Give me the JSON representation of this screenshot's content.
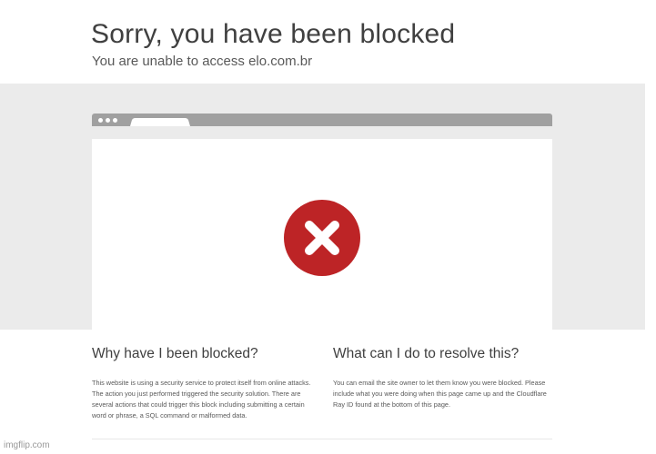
{
  "header": {
    "title": "Sorry, you have been blocked",
    "subtitle": "You are unable to access elo.com.br"
  },
  "illustration": {
    "icon": "error-x-icon",
    "icon_color": "#bd2426"
  },
  "why_blocked": {
    "heading": "Why have I been blocked?",
    "body": "This website is using a security service to protect itself from online attacks. The action you just performed triggered the security solution. There are several actions that could trigger this block including submitting a certain word or phrase, a SQL command or malformed data."
  },
  "resolve": {
    "heading": "What can I do to resolve this?",
    "body": "You can email the site owner to let them know you were blocked. Please include what you were doing when this page came up and the Cloudflare Ray ID found at the bottom of this page."
  },
  "watermark": "imgflip.com"
}
